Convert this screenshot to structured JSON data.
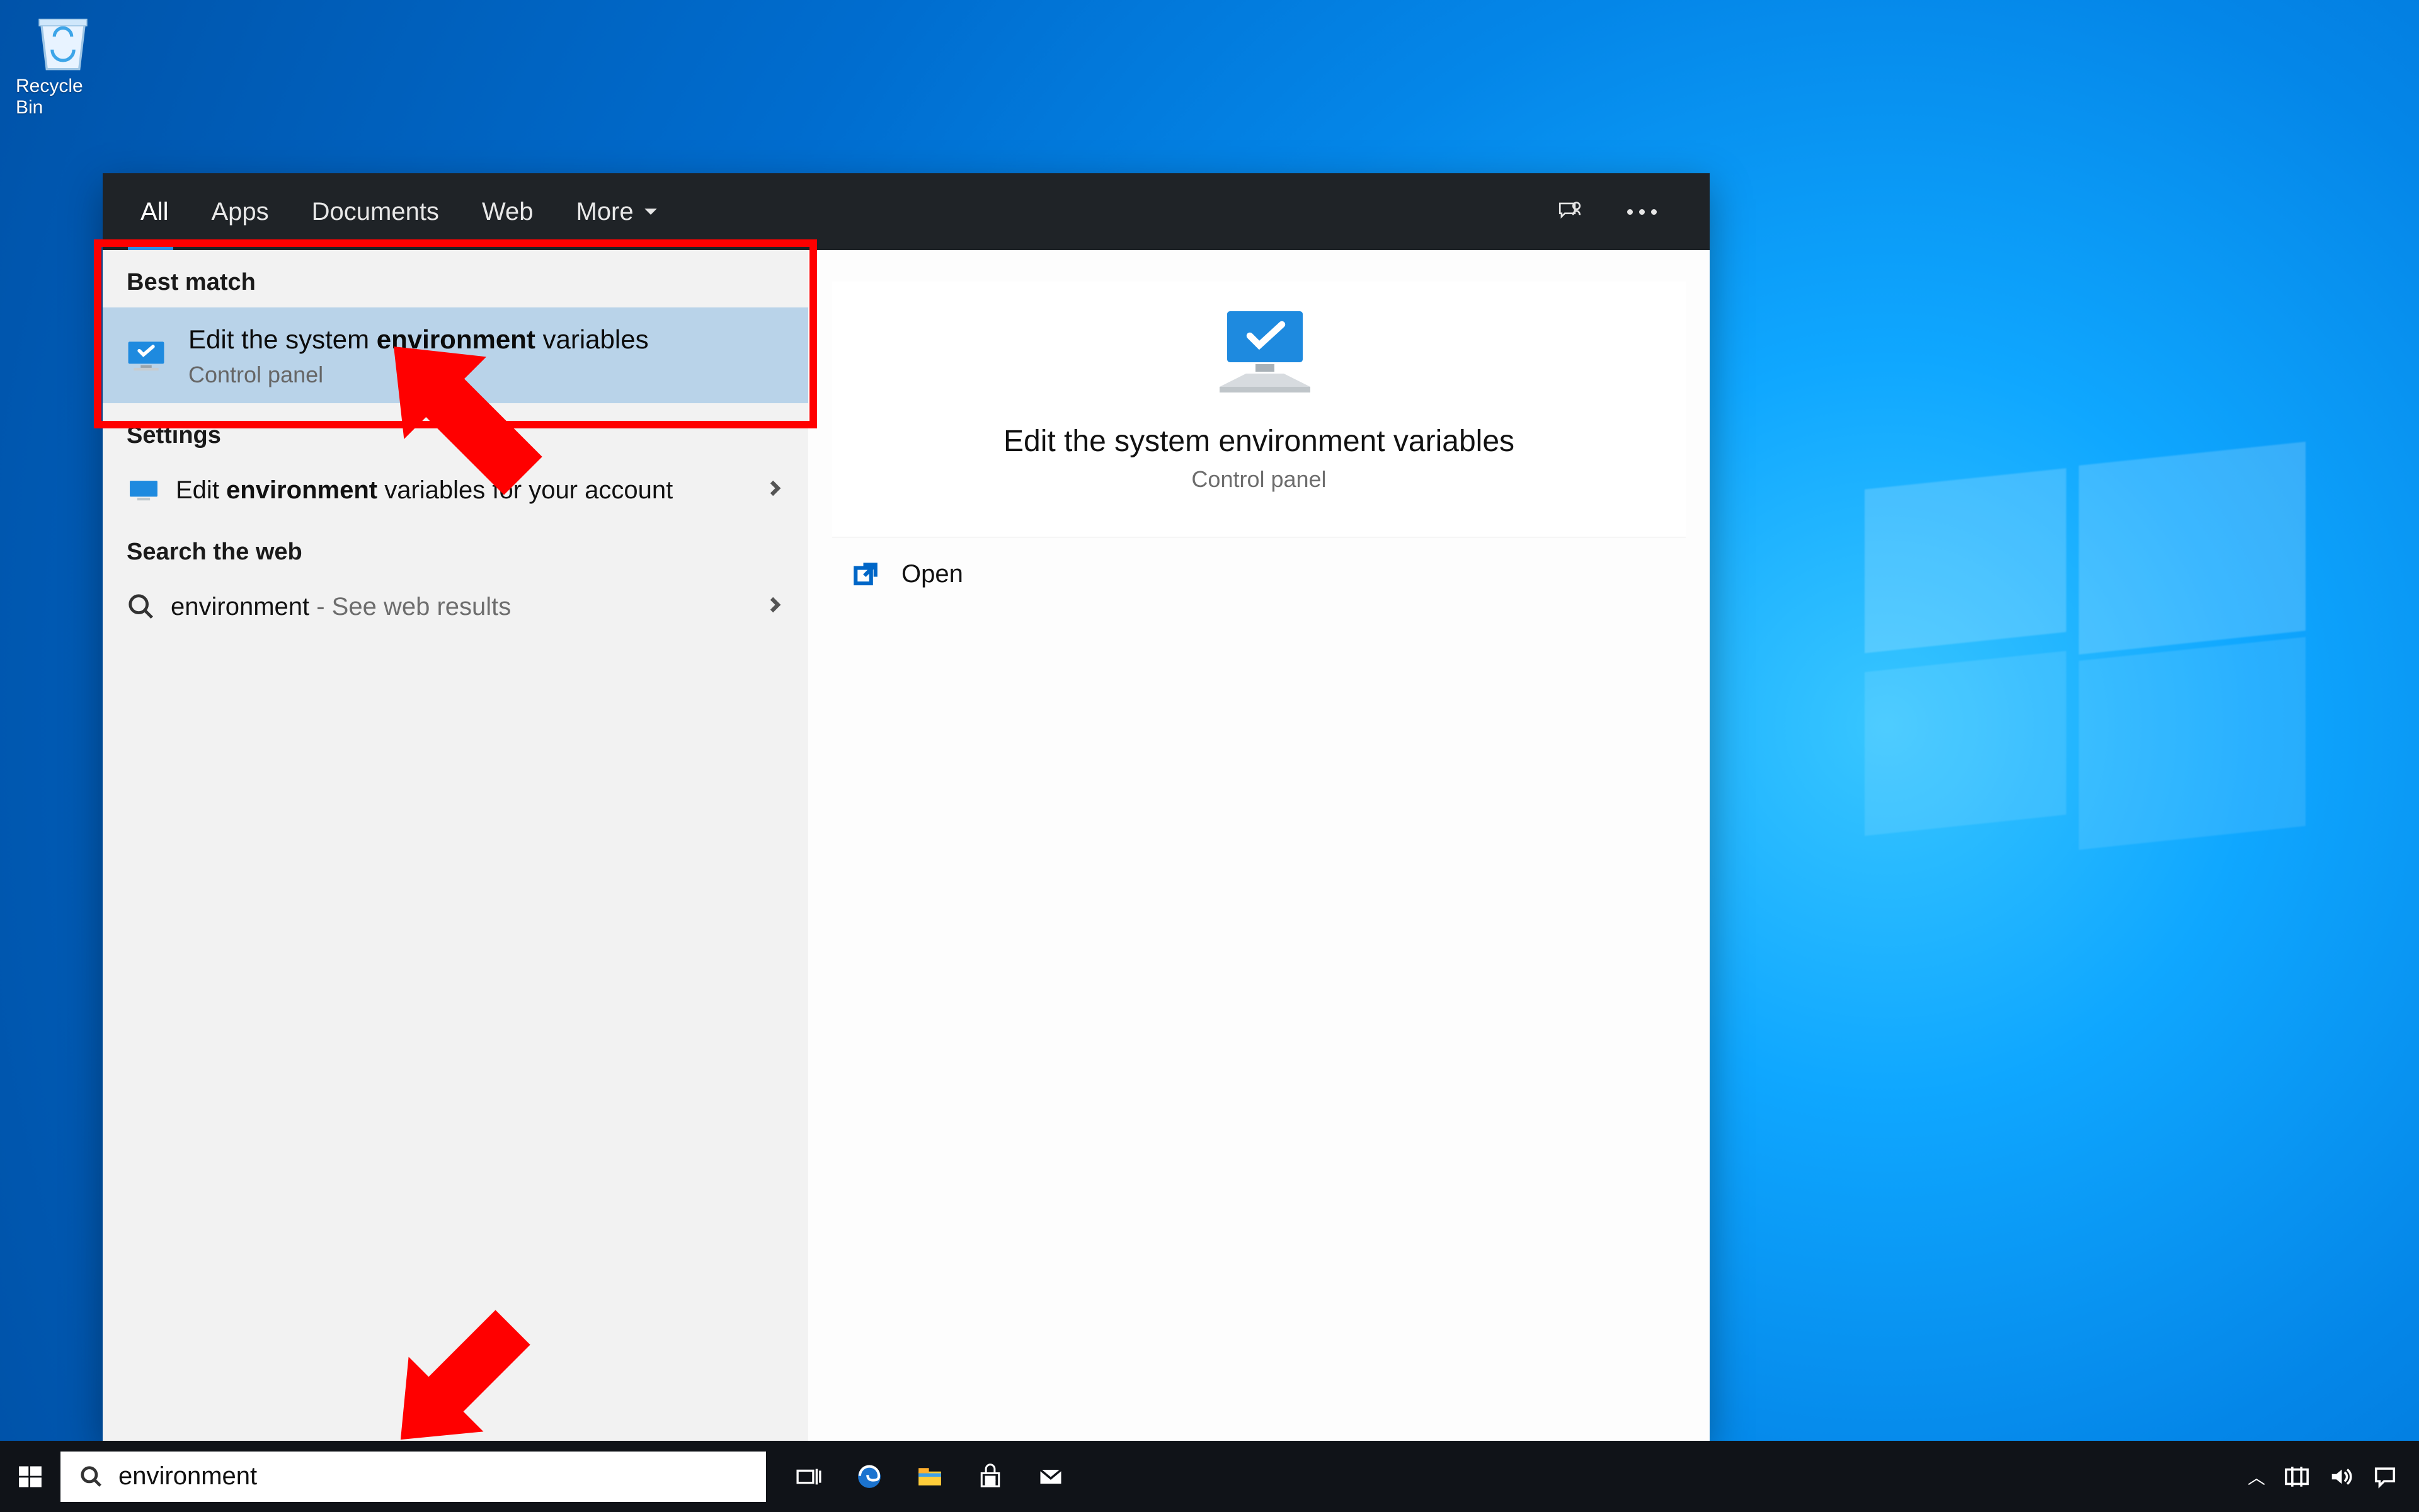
{
  "desktop": {
    "recycle_label": "Recycle Bin"
  },
  "panel": {
    "tabs": {
      "all": "All",
      "apps": "Apps",
      "documents": "Documents",
      "web": "Web",
      "more": "More"
    }
  },
  "results": {
    "best_label": "Best match",
    "best_title_pre": "Edit the system ",
    "best_title_bold": "environment",
    "best_title_post": " variables",
    "best_sub": "Control panel",
    "settings_label": "Settings",
    "settings_item_pre": "Edit ",
    "settings_item_bold": "environment",
    "settings_item_post": " variables for your account",
    "web_label": "Search the web",
    "web_item_term": "environment",
    "web_item_post": " - See web results"
  },
  "preview": {
    "title": "Edit the system environment variables",
    "sub": "Control panel",
    "open_label": "Open"
  },
  "search": {
    "value": "environment"
  }
}
